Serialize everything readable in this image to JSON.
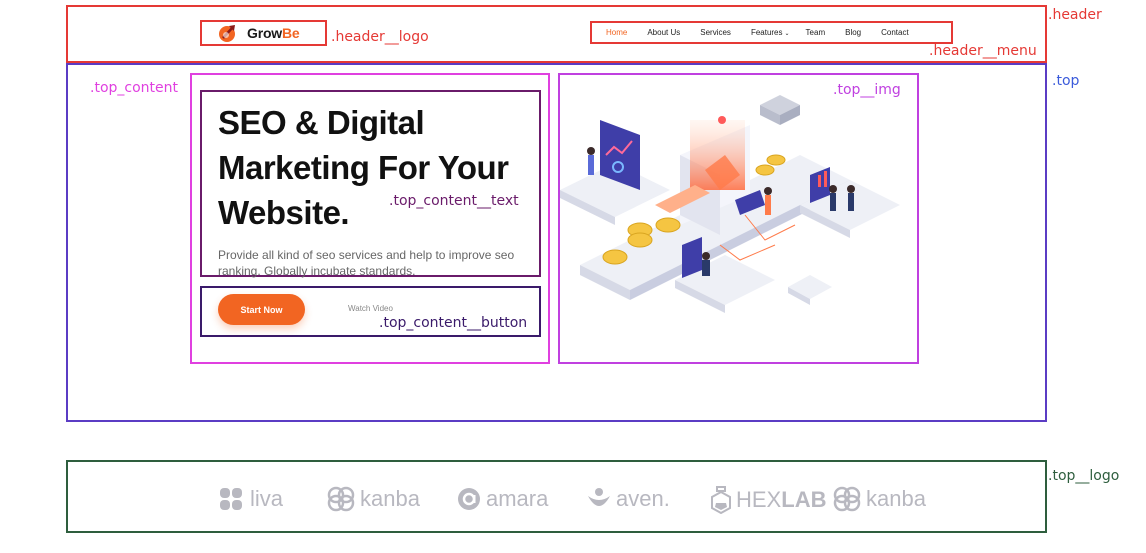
{
  "annotations": {
    "header": ".header",
    "header_logo": ".header__logo",
    "header_menu": ".header__menu",
    "top": ".top",
    "top_content": ".top_content",
    "top_img": ".top__img",
    "top_content_text": ".top_content__text",
    "top_content_button": ".top_content__button",
    "top_logo": ".top__logo"
  },
  "header": {
    "logo": {
      "text_main": "Grow",
      "text_accent": "Be"
    },
    "menu": [
      {
        "label": "Home",
        "active": true
      },
      {
        "label": "About Us",
        "active": false
      },
      {
        "label": "Services",
        "active": false
      },
      {
        "label": "Features",
        "active": false,
        "has_dropdown": true
      },
      {
        "label": "Team",
        "active": false
      },
      {
        "label": "Blog",
        "active": false
      },
      {
        "label": "Contact",
        "active": false
      }
    ]
  },
  "top": {
    "headline": "SEO & Digital Marketing For Your Website.",
    "description": "Provide all kind of seo services and help to improve seo ranking. Globally incubate standards.",
    "primary_button": "Start Now",
    "secondary_link": "Watch Video"
  },
  "partner_logos": [
    {
      "name": "liva",
      "icon": "liva-flower-icon"
    },
    {
      "name": "kanba",
      "icon": "kanba-rings-icon"
    },
    {
      "name": "amara",
      "icon": "amara-circle-icon"
    },
    {
      "name": "aven.",
      "icon": "aven-leaf-icon"
    },
    {
      "name_light": "HEX",
      "name_bold": "LAB",
      "icon": "hexlab-flask-icon"
    },
    {
      "name": "kanba",
      "icon": "kanba-rings-icon"
    }
  ],
  "colors": {
    "accent": "#f26522",
    "header_outline": "#e53935",
    "top_outline": "#5b3cc4",
    "content_outline": "#e040e0",
    "logo_outline": "#2e5e3e",
    "brand_gray": "#b8b8c0"
  }
}
